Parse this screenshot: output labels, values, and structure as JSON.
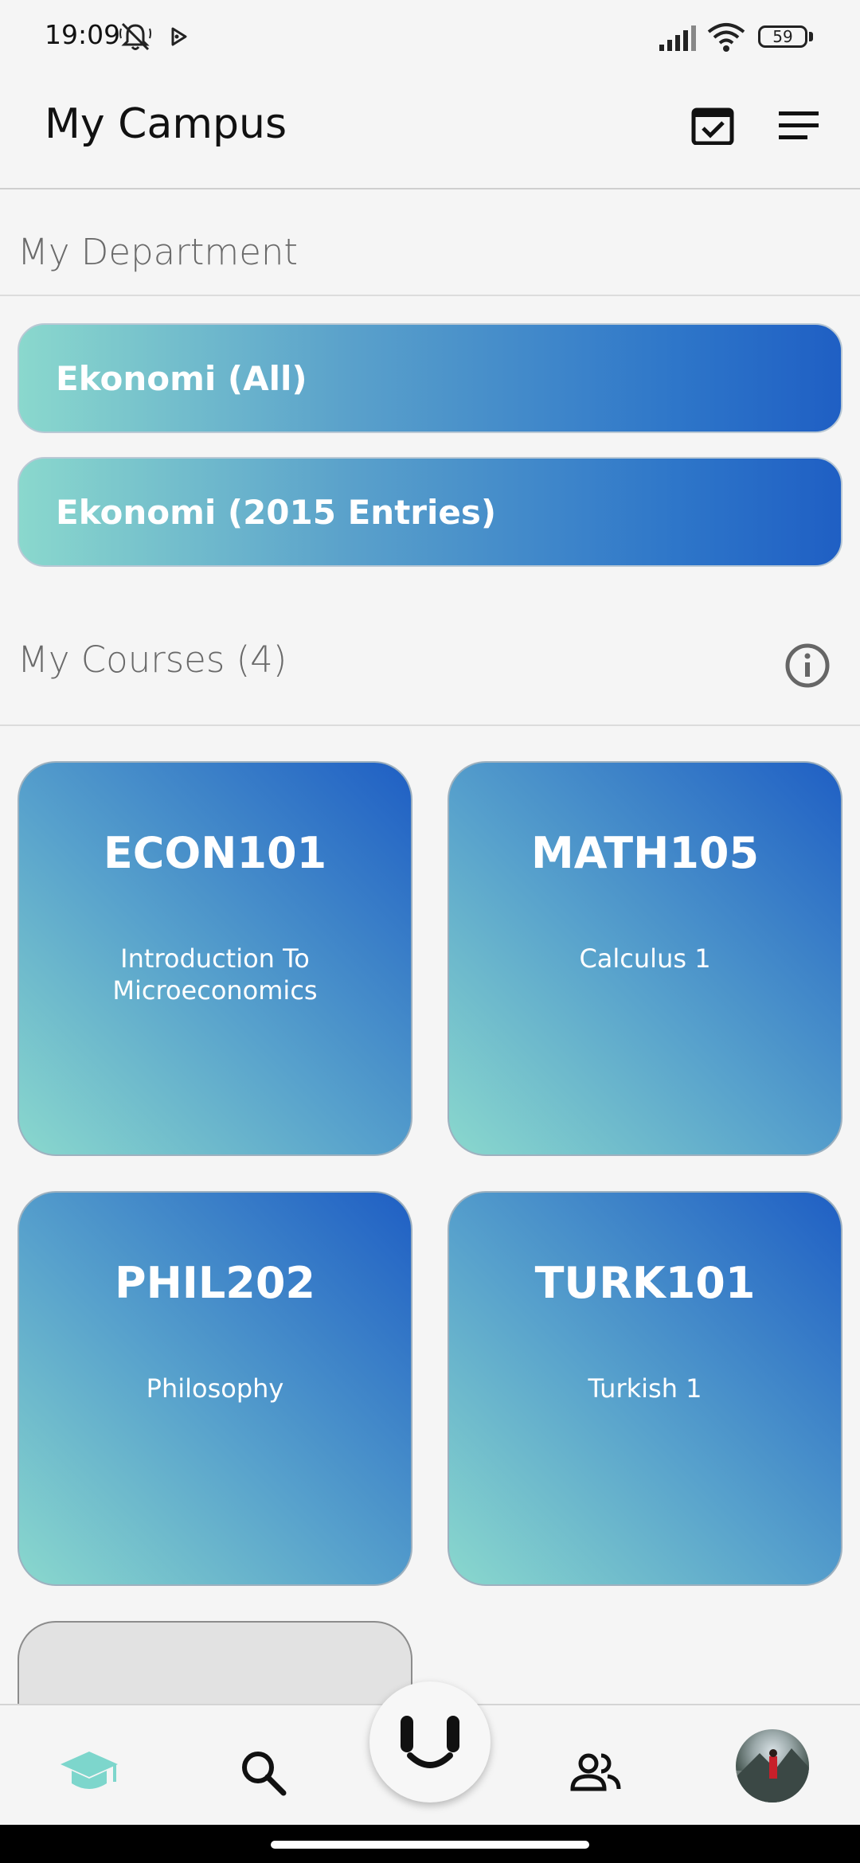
{
  "status_bar": {
    "time": "19:09",
    "battery": "59",
    "icons": [
      "mute-icon",
      "play-icon",
      "signal-icon",
      "wifi-icon",
      "battery-icon"
    ]
  },
  "header": {
    "title": "My Campus",
    "icons": [
      "calendar-check-icon",
      "menu-icon"
    ]
  },
  "department": {
    "title": "My Department",
    "items": [
      {
        "label": "Ekonomi (All)"
      },
      {
        "label": "Ekonomi (2015 Entries)"
      }
    ]
  },
  "courses": {
    "title": "My Courses (4)",
    "info_icon": "info-icon",
    "items": [
      {
        "code": "ECON101",
        "name": "Introduction To Microeconomics"
      },
      {
        "code": "MATH105",
        "name": "Calculus 1"
      },
      {
        "code": "PHIL202",
        "name": "Philosophy"
      },
      {
        "code": "TURK101",
        "name": "Turkish 1"
      }
    ]
  },
  "bottom_nav": {
    "items": [
      "graduation-cap-icon",
      "search-icon",
      "face-icon",
      "people-icon",
      "avatar"
    ],
    "active": "graduation-cap-icon"
  },
  "colors": {
    "accent": "#1f5fc4",
    "gradient_start": "#8ad8cd",
    "active_nav": "#7dd6cc"
  }
}
